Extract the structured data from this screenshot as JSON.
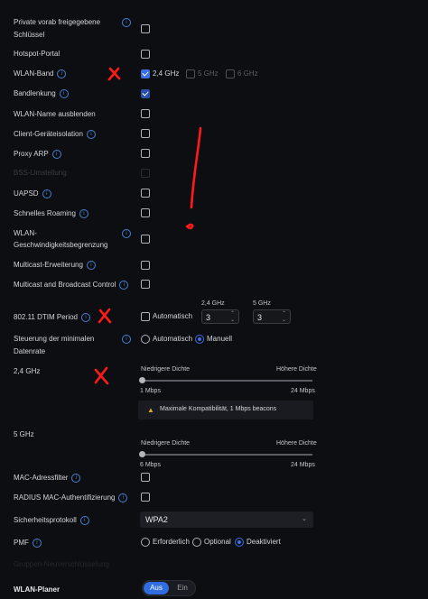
{
  "rows": {
    "private_key": {
      "line1": "Private vorab freigegebene",
      "line2": "Schlüssel"
    },
    "hotspot": "Hotspot-Portal",
    "band": "WLAN-Band",
    "band_options": [
      "2,4 GHz",
      "5 GHz",
      "6 GHz"
    ],
    "steering": "Bandlenkung",
    "hide_name": "WLAN-Name ausblenden",
    "isolation": "Client-Geräteisolation",
    "proxy_arp": "Proxy ARP",
    "bss": "BSS-Umstellung",
    "uapsd": "UAPSD",
    "roaming": "Schnelles Roaming",
    "speed_limit": {
      "line1": "WLAN-",
      "line2": "Geschwindigkeitsbegrenzung"
    },
    "multicast_ext": "Multicast-Erweiterung",
    "multicast_ctrl": "Multicast and Broadcast Control",
    "dtim": "802.11 DTIM Period",
    "dtim_auto": "Automatisch",
    "dtim_24_label": "2,4 GHz",
    "dtim_24_value": "3",
    "dtim_5_label": "5 GHz",
    "dtim_5_value": "3",
    "min_rate": {
      "line1": "Steuerung der minimalen",
      "line2": "Datenrate"
    },
    "min_rate_auto": "Automatisch",
    "min_rate_manual": "Manuell",
    "g24": "2,4 GHz",
    "g5": "5 GHz",
    "low_density": "Niedrigere Dichte",
    "high_density": "Höhere Dichte",
    "s24_min": "1 Mbps",
    "s24_max": "24 Mbps",
    "s24_level": 0,
    "warning": "Maximale Kompatibilität, 1 Mbps beacons",
    "s5_min": "6 Mbps",
    "s5_max": "24 Mbps",
    "s5_level": 0,
    "mac_filter": "MAC-Adressfilter",
    "radius": "RADIUS MAC-Authentifizierung",
    "security": "Sicherheitsprotokoll",
    "security_value": "WPA2",
    "pmf": "PMF",
    "pmf_options": [
      "Erforderlich",
      "Optional",
      "Deaktiviert"
    ],
    "hidden_row": "Gruppen-Neuverschlüsselung",
    "planner": "WLAN-Planer",
    "planner_on": "Aus",
    "planner_off": "Ein"
  },
  "colors": {
    "accent": "#3b6fe6",
    "markup": "#ff1a1a",
    "warning": "#e0a63a"
  }
}
